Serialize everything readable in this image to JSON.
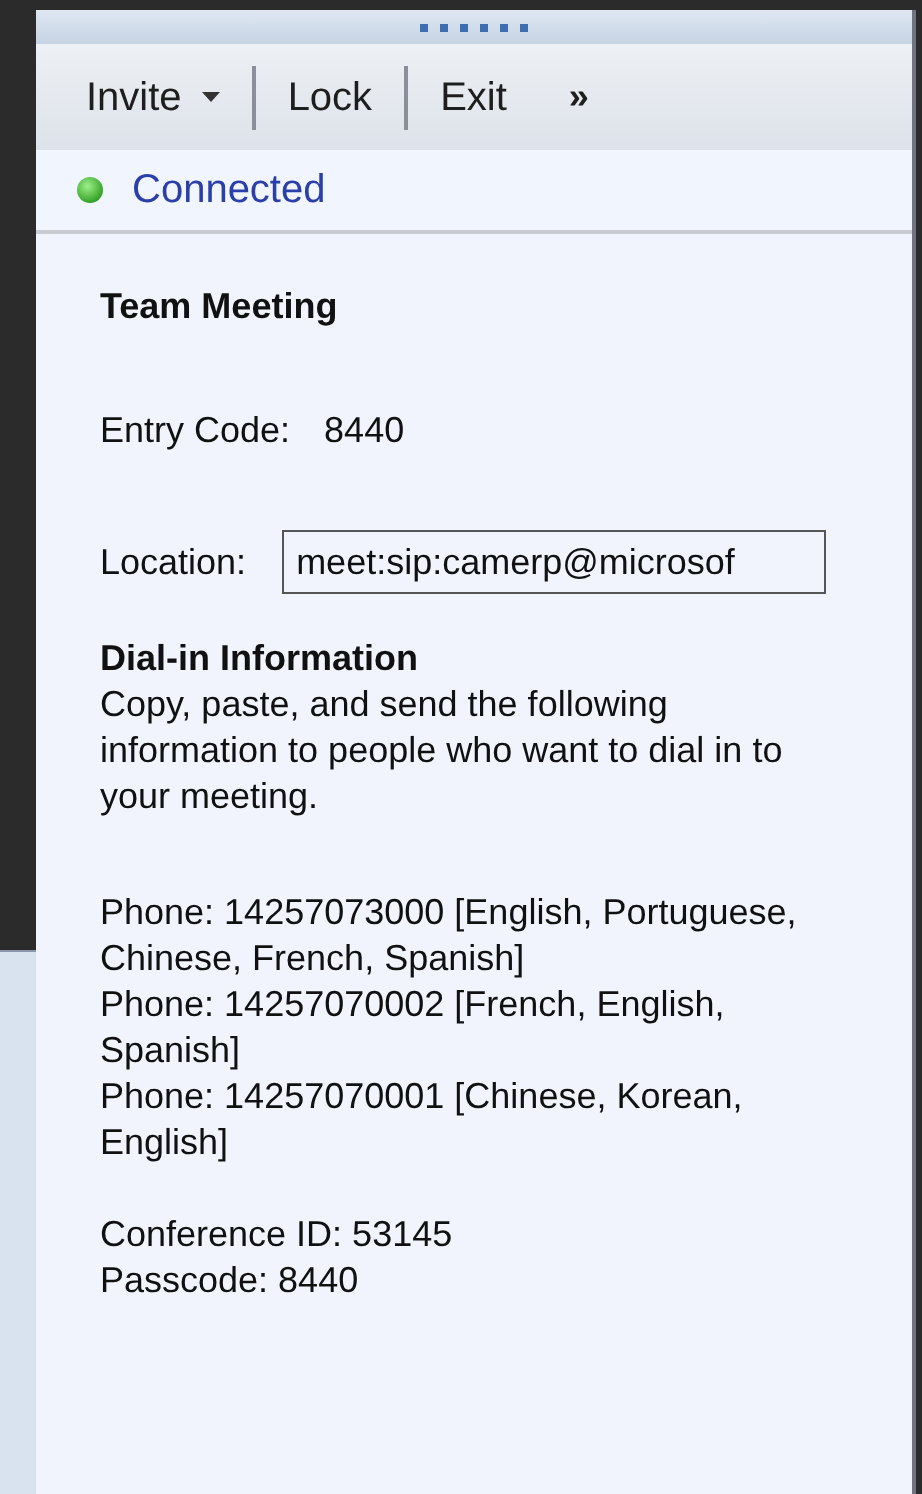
{
  "toolbar": [
    {
      "label": "Invite",
      "kind": "dropdown"
    },
    {
      "label": "Lock",
      "kind": "button"
    },
    {
      "label": "Exit",
      "kind": "button"
    },
    {
      "label": "»",
      "kind": "overflow"
    }
  ],
  "status": {
    "label": "Connected"
  },
  "meeting": {
    "title": "Team Meeting",
    "entry_code_label": "Entry Code:",
    "entry_code": "8440",
    "location_label": "Location:",
    "location": "meet:sip:camerp@microsof"
  },
  "dial_in": {
    "heading": "Dial-in Information",
    "intro": "Copy, paste, and send the following information to people who want to dial in to your meeting.",
    "phones": [
      "Phone: 14257073000 [English, Portuguese, Chinese, French, Spanish]",
      "Phone: 14257070002 [French, English, Spanish]",
      "Phone: 14257070001 [Chinese, Korean, English]"
    ],
    "conference_id": "Conference ID: 53145",
    "passcode": "Passcode: 8440"
  }
}
